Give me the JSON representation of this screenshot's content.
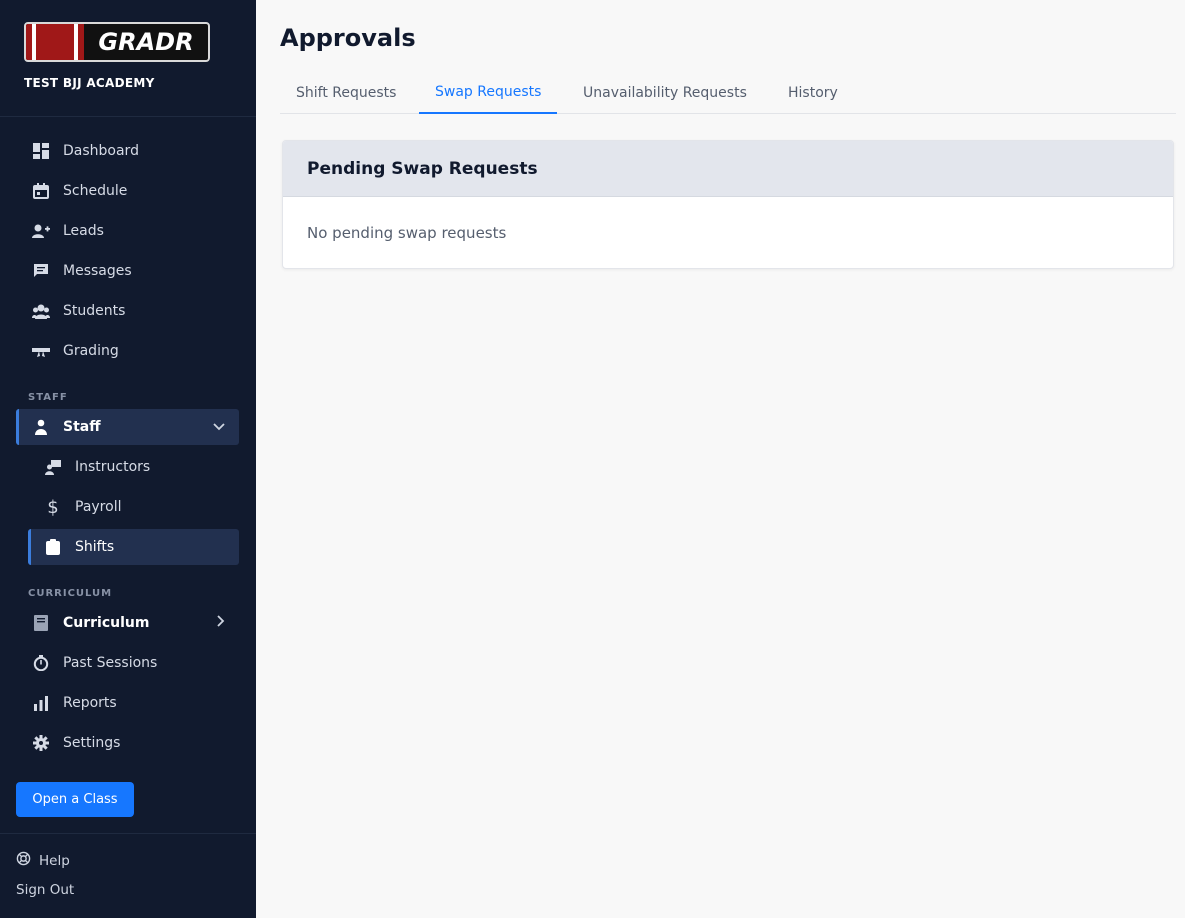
{
  "brand": {
    "logo_text": "GRADR",
    "academy": "TEST BJJ ACADEMY"
  },
  "nav": {
    "main_items": [
      {
        "label": "Dashboard",
        "icon": "dashboard-icon"
      },
      {
        "label": "Schedule",
        "icon": "calendar-icon"
      },
      {
        "label": "Leads",
        "icon": "person-add-icon"
      },
      {
        "label": "Messages",
        "icon": "chat-icon"
      },
      {
        "label": "Students",
        "icon": "group-icon"
      },
      {
        "label": "Grading",
        "icon": "belt-icon"
      }
    ],
    "staff_section": "STAFF",
    "staff": {
      "label": "Staff",
      "expanded": true
    },
    "staff_sub": [
      {
        "label": "Instructors",
        "icon": "instructor-icon"
      },
      {
        "label": "Payroll",
        "icon": "dollar-icon"
      },
      {
        "label": "Shifts",
        "icon": "clipboard-icon",
        "active": true
      }
    ],
    "curriculum_section": "CURRICULUM",
    "curriculum": {
      "label": "Curriculum",
      "expanded": false
    },
    "other_items": [
      {
        "label": "Past Sessions",
        "icon": "stopwatch-icon"
      },
      {
        "label": "Reports",
        "icon": "bar-chart-icon"
      },
      {
        "label": "Settings",
        "icon": "gear-icon"
      }
    ],
    "open_class": "Open a Class",
    "help": "Help",
    "sign_out": "Sign Out"
  },
  "page": {
    "title": "Approvals",
    "tabs": [
      {
        "label": "Shift Requests"
      },
      {
        "label": "Swap Requests",
        "active": true
      },
      {
        "label": "Unavailability Requests"
      },
      {
        "label": "History"
      }
    ],
    "card": {
      "title": "Pending Swap Requests",
      "empty_text": "No pending swap requests"
    }
  },
  "colors": {
    "sidebar_bg": "#111a2e",
    "accent": "#1677ff",
    "active_item_bg": "#22304f"
  }
}
